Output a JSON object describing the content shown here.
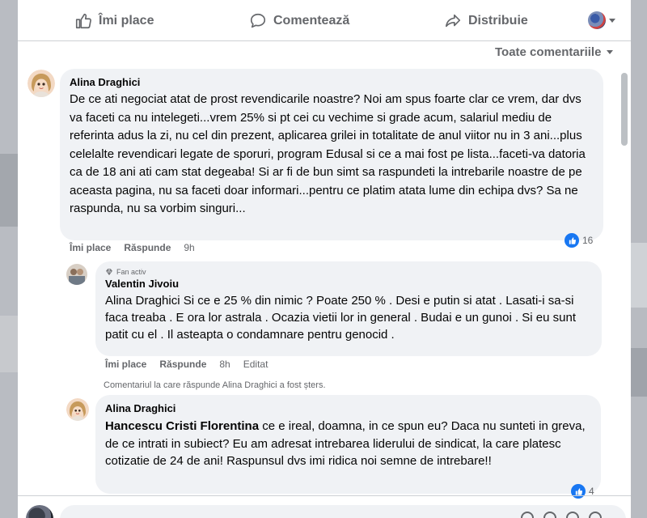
{
  "actions": {
    "like_label": "Îmi place",
    "comment_label": "Comentează",
    "share_label": "Distribuie"
  },
  "sort": {
    "label": "Toate comentariile"
  },
  "comments": [
    {
      "author": "Alina Draghici",
      "text": "De ce ati negociat atat de prost revendicarile noastre? Noi am spus foarte clar ce vrem, dar dvs va faceti ca nu intelegeti...vrem 25% si pt cei cu vechime si grade acum, salariul mediu de referinta adus la zi, nu cel din prezent, aplicarea grilei in totalitate de anul viitor nu in 3 ani...plus celelalte revendicari legate de sporuri, program Edusal si ce a mai fost pe lista...faceti-va datoria ca de 18 ani ati cam stat degeaba! Si ar fi de bun simt sa raspundeti la intrebarile noastre de pe aceasta pagina, nu sa faceti doar informari...pentru ce platim atata lume din echipa dvs? Sa ne raspunda, nu sa vorbim singuri...",
      "like_label": "Îmi place",
      "reply_label": "Răspunde",
      "time": "9h",
      "reactions": "16"
    },
    {
      "badge": "Fan activ",
      "author": "Valentin Jivoiu",
      "text": "Alina Draghici Si ce e 25 % din nimic ? Poate 250 % . Desi e putin si atat . Lasati-i sa-si faca treaba . E ora lor astrala . Ocazia vietii lor in general . Budai e un gunoi . Si eu sunt patit cu el . Il asteapta o condamnare pentru genocid .",
      "like_label": "Îmi place",
      "reply_label": "Răspunde",
      "time": "8h",
      "edited": "Editat"
    },
    {
      "author": "Alina Draghici",
      "mention": "Hancescu Cristi Florentina",
      "text": " ce e ireal, doamna, in ce spun eu? Daca nu sunteti in greva, de ce intrati in subiect? Eu am adresat intrebarea liderului de sindicat, la care platesc cotizatie de 24 de ani! Raspunsul dvs imi ridica noi semne de intrebare!!",
      "reactions": "4"
    }
  ],
  "deleted_note": "Comentariul la care răspunde Alina Draghici a fost șters.",
  "colors": {
    "accent": "#1877f2",
    "bubble": "#f0f2f5",
    "muted_text": "#65676b"
  }
}
